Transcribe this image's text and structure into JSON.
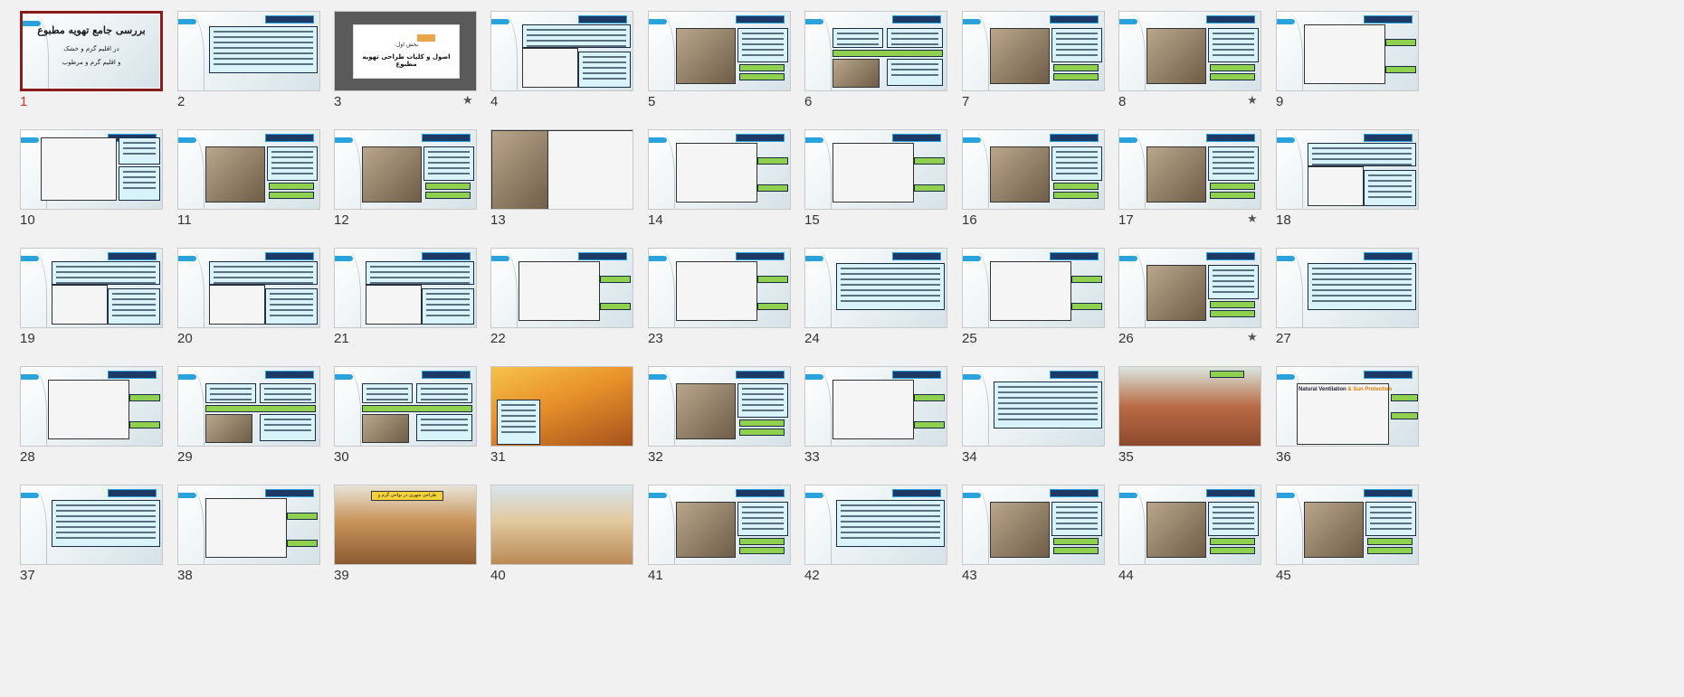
{
  "slides": [
    {
      "n": "1",
      "selected": true,
      "star": false,
      "kind": "title",
      "title": "بررسی جامع تهویه مطبوع",
      "line2": "در اقلیم گرم و خشک",
      "line3": "و اقلیم گرم و مرطوب"
    },
    {
      "n": "2",
      "selected": false,
      "star": false,
      "kind": "text"
    },
    {
      "n": "3",
      "selected": false,
      "star": true,
      "kind": "section",
      "sub": "بخش اول:",
      "heading": "اصول و کلیات طراحی تهویه مطبوع"
    },
    {
      "n": "4",
      "selected": false,
      "star": false,
      "kind": "text-img"
    },
    {
      "n": "5",
      "selected": false,
      "star": false,
      "kind": "img-text"
    },
    {
      "n": "6",
      "selected": false,
      "star": false,
      "kind": "diagram"
    },
    {
      "n": "7",
      "selected": false,
      "star": false,
      "kind": "img-text"
    },
    {
      "n": "8",
      "selected": false,
      "star": true,
      "kind": "img-text"
    },
    {
      "n": "9",
      "selected": false,
      "star": false,
      "kind": "sketch"
    },
    {
      "n": "10",
      "selected": false,
      "star": false,
      "kind": "chart"
    },
    {
      "n": "11",
      "selected": false,
      "star": false,
      "kind": "img-text"
    },
    {
      "n": "12",
      "selected": false,
      "star": false,
      "kind": "img-text"
    },
    {
      "n": "13",
      "selected": false,
      "star": false,
      "kind": "photo-sketch"
    },
    {
      "n": "14",
      "selected": false,
      "star": false,
      "kind": "sketch"
    },
    {
      "n": "15",
      "selected": false,
      "star": false,
      "kind": "sketch"
    },
    {
      "n": "16",
      "selected": false,
      "star": false,
      "kind": "img-text"
    },
    {
      "n": "17",
      "selected": false,
      "star": true,
      "kind": "img-text"
    },
    {
      "n": "18",
      "selected": false,
      "star": false,
      "kind": "text-img"
    },
    {
      "n": "19",
      "selected": false,
      "star": false,
      "kind": "text-img"
    },
    {
      "n": "20",
      "selected": false,
      "star": false,
      "kind": "text-img"
    },
    {
      "n": "21",
      "selected": false,
      "star": false,
      "kind": "text-img"
    },
    {
      "n": "22",
      "selected": false,
      "star": false,
      "kind": "sketch"
    },
    {
      "n": "23",
      "selected": false,
      "star": false,
      "kind": "sketch"
    },
    {
      "n": "24",
      "selected": false,
      "star": false,
      "kind": "text"
    },
    {
      "n": "25",
      "selected": false,
      "star": false,
      "kind": "sketch"
    },
    {
      "n": "26",
      "selected": false,
      "star": true,
      "kind": "img-text"
    },
    {
      "n": "27",
      "selected": false,
      "star": false,
      "kind": "text"
    },
    {
      "n": "28",
      "selected": false,
      "star": false,
      "kind": "sketch"
    },
    {
      "n": "29",
      "selected": false,
      "star": false,
      "kind": "diagram"
    },
    {
      "n": "30",
      "selected": false,
      "star": false,
      "kind": "diagram"
    },
    {
      "n": "31",
      "selected": false,
      "star": false,
      "kind": "sun"
    },
    {
      "n": "32",
      "selected": false,
      "star": false,
      "kind": "img-text"
    },
    {
      "n": "33",
      "selected": false,
      "star": false,
      "kind": "sketch"
    },
    {
      "n": "34",
      "selected": false,
      "star": false,
      "kind": "text"
    },
    {
      "n": "35",
      "selected": false,
      "star": false,
      "kind": "mud"
    },
    {
      "n": "36",
      "selected": false,
      "star": false,
      "kind": "nv",
      "nv1": "Natural Ventilation",
      "nv2": "&",
      "nv3": "Sun Protection"
    },
    {
      "n": "37",
      "selected": false,
      "star": false,
      "kind": "text"
    },
    {
      "n": "38",
      "selected": false,
      "star": false,
      "kind": "sketch"
    },
    {
      "n": "39",
      "selected": false,
      "star": false,
      "kind": "city",
      "banner": "طراحی شهری در نواحی گرم و خشک"
    },
    {
      "n": "40",
      "selected": false,
      "star": false,
      "kind": "desert"
    },
    {
      "n": "41",
      "selected": false,
      "star": false,
      "kind": "img-text"
    },
    {
      "n": "42",
      "selected": false,
      "star": false,
      "kind": "text"
    },
    {
      "n": "43",
      "selected": false,
      "star": false,
      "kind": "img-text"
    },
    {
      "n": "44",
      "selected": false,
      "star": false,
      "kind": "img-text"
    },
    {
      "n": "45",
      "selected": false,
      "star": false,
      "kind": "img-text"
    }
  ],
  "colors": {
    "selected_border": "#8b1a1a",
    "accent_tab": "#2aa2dd",
    "header_bar": "#1d3a66",
    "text_box": "#d9f3fb",
    "green_label": "#8fd14f"
  },
  "icons": {
    "star": "star-icon"
  }
}
